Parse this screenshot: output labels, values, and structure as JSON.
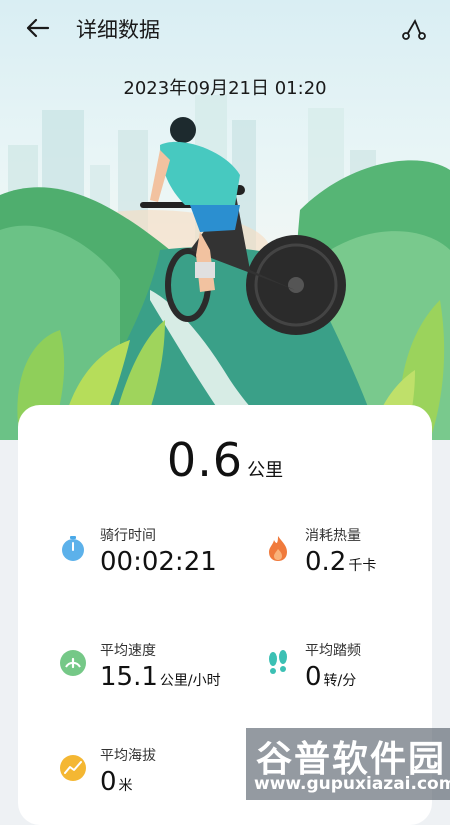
{
  "header": {
    "title": "详细数据",
    "back_icon": "back-arrow-icon",
    "share_icon": "share-route-icon"
  },
  "datetime": "2023年09月21日 01:20",
  "distance": {
    "value": "0.6",
    "unit": "公里"
  },
  "stats": [
    {
      "label": "骑行时间",
      "value": "00:02:21",
      "unit": "",
      "icon": "stopwatch-icon",
      "color": "#4aa9e8"
    },
    {
      "label": "消耗热量",
      "value": "0.2",
      "unit": "千卡",
      "icon": "flame-icon",
      "color": "#f07a3c"
    },
    {
      "label": "平均速度",
      "value": "15.1",
      "unit": "公里/小时",
      "icon": "speedometer-icon",
      "color": "#66c27a"
    },
    {
      "label": "平均踏频",
      "value": "0",
      "unit": "转/分",
      "icon": "footprints-icon",
      "color": "#3cc0b4"
    },
    {
      "label": "平均海拔",
      "value": "0",
      "unit": "米",
      "icon": "altitude-icon",
      "color": "#f4b733"
    }
  ],
  "watermark": {
    "line1": "谷普软件园",
    "line2": "www.gupuxiazai.com"
  }
}
